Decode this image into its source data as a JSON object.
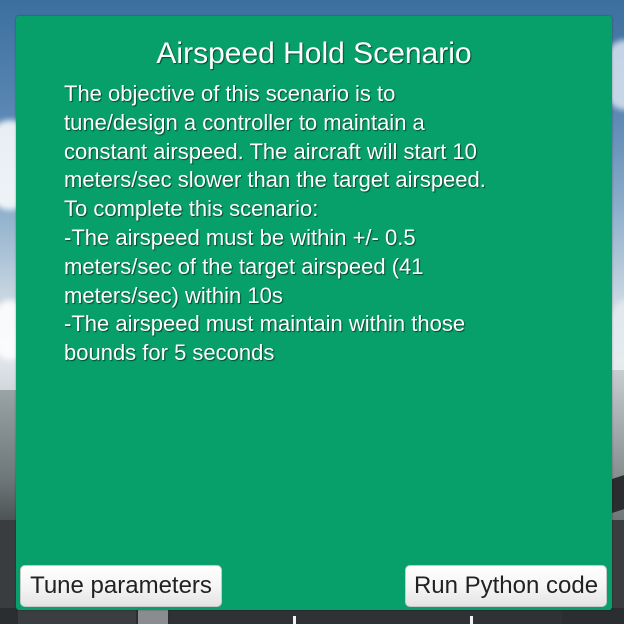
{
  "panel": {
    "title": "Airspeed Hold Scenario",
    "description_lines": [
      "The objective of this scenario is to",
      "tune/design a controller to maintain a",
      "constant airspeed. The aircraft will start 10",
      "meters/sec slower than the target airspeed.",
      "To complete this scenario:",
      "-The airspeed must be within +/- 0.5",
      "meters/sec of the target airspeed (41",
      "meters/sec) within 10s",
      "-The airspeed must maintain within those",
      "bounds for 5 seconds"
    ],
    "background_color": "#07a06a"
  },
  "buttons": {
    "tune_label": "Tune parameters",
    "run_label": "Run Python code"
  }
}
